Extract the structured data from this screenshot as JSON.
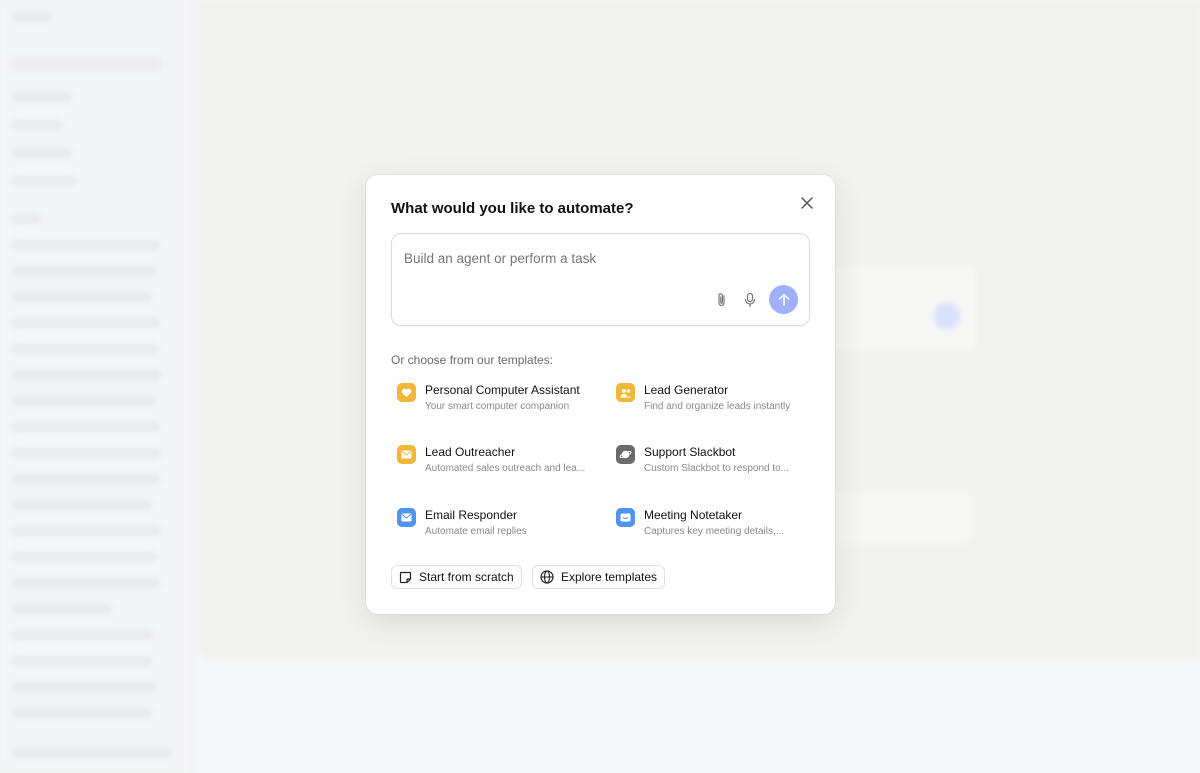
{
  "modal": {
    "title": "What would you like to automate?",
    "close_icon": "close-icon",
    "prompt": {
      "placeholder": "Build an agent or perform a task",
      "value": "",
      "attach_icon": "paperclip-icon",
      "mic_icon": "microphone-icon",
      "send_icon": "arrow-up-icon"
    },
    "templates_label": "Or choose from our templates:",
    "templates": [
      {
        "title": "Personal Computer Assistant",
        "description": "Your smart computer companion",
        "icon": "heart-icon",
        "color": "#f1b739"
      },
      {
        "title": "Lead Generator",
        "description": "Find and organize leads instantly",
        "icon": "people-icon",
        "color": "#f1b739"
      },
      {
        "title": "Lead Outreacher",
        "description": "Automated sales outreach and lea...",
        "icon": "mail-icon",
        "color": "#f1b739"
      },
      {
        "title": "Support Slackbot",
        "description": "Custom Slackbot to respond to...",
        "icon": "planet-icon",
        "color": "#6b6b6b"
      },
      {
        "title": "Email Responder",
        "description": "Automate email replies",
        "icon": "mail-icon",
        "color": "#4f94ee"
      },
      {
        "title": "Meeting Notetaker",
        "description": "Captures key meeting details,...",
        "icon": "chat-icon",
        "color": "#4f94ee"
      }
    ],
    "buttons": {
      "start_scratch": "Start from scratch",
      "explore_templates": "Explore templates"
    }
  }
}
